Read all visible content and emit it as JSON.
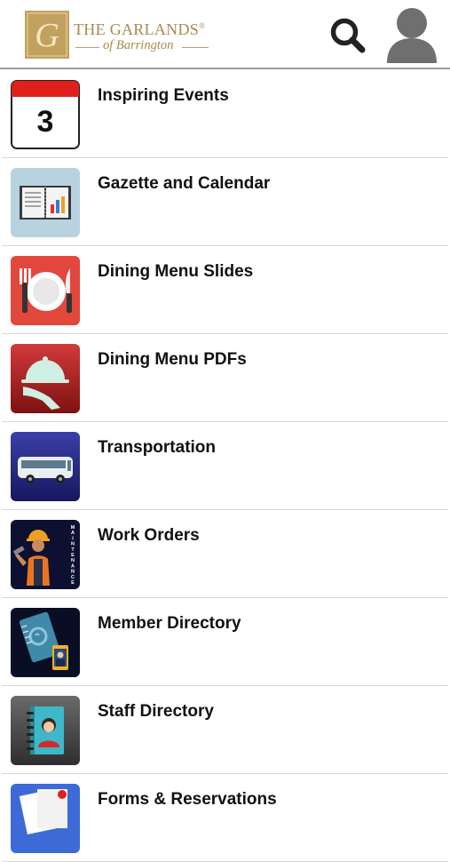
{
  "header": {
    "brand_name": "THE GARLANDS",
    "brand_sub": "of Barrington",
    "registered": "®",
    "search_icon": "search-icon",
    "profile_icon": "user-avatar-icon"
  },
  "menu": {
    "items": [
      {
        "label": "Inspiring Events",
        "icon": "calendar-icon",
        "day": "3"
      },
      {
        "label": "Gazette and Calendar",
        "icon": "gazette-icon"
      },
      {
        "label": "Dining Menu Slides",
        "icon": "plate-cutlery-icon"
      },
      {
        "label": "Dining Menu PDFs",
        "icon": "cloche-icon"
      },
      {
        "label": "Transportation",
        "icon": "bus-icon"
      },
      {
        "label": "Work Orders",
        "icon": "maintenance-worker-icon",
        "side_text": "MAINTENANCE"
      },
      {
        "label": "Member Directory",
        "icon": "member-directory-icon"
      },
      {
        "label": "Staff Directory",
        "icon": "staff-directory-icon"
      },
      {
        "label": "Forms & Reservations",
        "icon": "forms-icon"
      }
    ]
  },
  "colors": {
    "brand_gold": "#a88a4c",
    "divider": "#d7d7d7",
    "text": "#111111"
  }
}
